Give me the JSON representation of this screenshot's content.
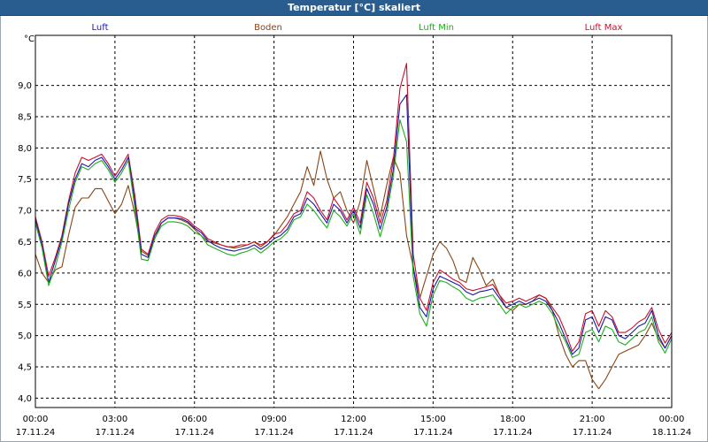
{
  "window": {
    "title": "Temperatur [°C] skaliert"
  },
  "chart_data": {
    "type": "line",
    "title": "Temperatur [°C] skaliert",
    "ylabel": "°C",
    "ylim": [
      3.85,
      9.8
    ],
    "xlim": [
      0,
      24
    ],
    "grid": true,
    "legend_position": "top",
    "y_ticks": [
      "4,0",
      "4,5",
      "5,0",
      "5,5",
      "6,0",
      "6,5",
      "7,0",
      "7,5",
      "8,0",
      "8,5",
      "9,0"
    ],
    "y_tick_values": [
      4.0,
      4.5,
      5.0,
      5.5,
      6.0,
      6.5,
      7.0,
      7.5,
      8.0,
      8.5,
      9.0
    ],
    "x_ticks": [
      {
        "time": "00:00",
        "date": "17.11.24"
      },
      {
        "time": "03:00",
        "date": "17.11.24"
      },
      {
        "time": "06:00",
        "date": "17.11.24"
      },
      {
        "time": "09:00",
        "date": "17.11.24"
      },
      {
        "time": "12:00",
        "date": "17.11.24"
      },
      {
        "time": "15:00",
        "date": "17.11.24"
      },
      {
        "time": "18:00",
        "date": "17.11.24"
      },
      {
        "time": "21:00",
        "date": "17.11.24"
      },
      {
        "time": "00:00",
        "date": "18.11.24"
      }
    ],
    "x_tick_values": [
      0,
      3,
      6,
      9,
      12,
      15,
      18,
      21,
      24
    ],
    "x": [
      0,
      0.25,
      0.5,
      0.75,
      1,
      1.25,
      1.5,
      1.75,
      2,
      2.25,
      2.5,
      2.75,
      3,
      3.25,
      3.5,
      3.75,
      4,
      4.25,
      4.5,
      4.75,
      5,
      5.25,
      5.5,
      5.75,
      6,
      6.25,
      6.5,
      6.75,
      7,
      7.25,
      7.5,
      7.75,
      8,
      8.25,
      8.5,
      8.75,
      9,
      9.25,
      9.5,
      9.75,
      10,
      10.25,
      10.5,
      10.75,
      11,
      11.25,
      11.5,
      11.75,
      12,
      12.25,
      12.5,
      12.75,
      13,
      13.25,
      13.5,
      13.75,
      14,
      14.25,
      14.5,
      14.75,
      15,
      15.25,
      15.5,
      15.75,
      16,
      16.25,
      16.5,
      16.75,
      17,
      17.25,
      17.5,
      17.75,
      18,
      18.25,
      18.5,
      18.75,
      19,
      19.25,
      19.5,
      19.75,
      20,
      20.25,
      20.5,
      20.75,
      21,
      21.25,
      21.5,
      21.75,
      22,
      22.25,
      22.5,
      22.75,
      23,
      23.25,
      23.5,
      23.75,
      24
    ],
    "series": [
      {
        "name": "Luft",
        "color": "#1a1aa8",
        "values": [
          6.85,
          6.45,
          5.85,
          6.2,
          6.55,
          7.1,
          7.5,
          7.75,
          7.7,
          7.8,
          7.85,
          7.7,
          7.5,
          7.65,
          7.85,
          7.15,
          6.3,
          6.25,
          6.6,
          6.8,
          6.88,
          6.88,
          6.87,
          6.82,
          6.72,
          6.65,
          6.52,
          6.45,
          6.4,
          6.37,
          6.35,
          6.38,
          6.4,
          6.45,
          6.38,
          6.45,
          6.55,
          6.6,
          6.7,
          6.9,
          6.95,
          7.2,
          7.1,
          6.95,
          6.8,
          7.1,
          7.0,
          6.8,
          7.0,
          6.72,
          7.35,
          7.1,
          6.7,
          7.05,
          7.65,
          8.7,
          8.85,
          6.1,
          5.45,
          5.3,
          5.75,
          5.95,
          5.9,
          5.85,
          5.8,
          5.7,
          5.65,
          5.7,
          5.72,
          5.75,
          5.6,
          5.45,
          5.5,
          5.55,
          5.5,
          5.55,
          5.6,
          5.55,
          5.4,
          5.2,
          4.95,
          4.7,
          4.8,
          5.25,
          5.3,
          5.05,
          5.3,
          5.25,
          5.0,
          4.95,
          5.05,
          5.15,
          5.2,
          5.4,
          5.0,
          4.8,
          5.0,
          5.2,
          5.25
        ]
      },
      {
        "name": "Boden",
        "color": "#8b4513",
        "values": [
          6.3,
          6.0,
          5.85,
          6.05,
          6.1,
          6.6,
          7.05,
          7.2,
          7.2,
          7.35,
          7.35,
          7.15,
          6.95,
          7.1,
          7.4,
          6.95,
          6.35,
          6.28,
          6.55,
          6.8,
          6.88,
          6.88,
          6.85,
          6.8,
          6.7,
          6.6,
          6.5,
          6.48,
          6.45,
          6.42,
          6.4,
          6.42,
          6.45,
          6.5,
          6.42,
          6.5,
          6.6,
          6.75,
          6.9,
          7.1,
          7.3,
          7.7,
          7.4,
          7.95,
          7.5,
          7.2,
          7.3,
          7.0,
          6.8,
          7.15,
          7.8,
          7.35,
          6.9,
          7.4,
          7.85,
          7.6,
          6.6,
          6.1,
          5.6,
          5.95,
          6.3,
          6.5,
          6.4,
          6.2,
          5.9,
          5.85,
          6.25,
          6.05,
          5.8,
          5.9,
          5.65,
          5.45,
          5.4,
          5.5,
          5.5,
          5.55,
          5.65,
          5.6,
          5.4,
          5.0,
          4.7,
          4.5,
          4.6,
          4.6,
          4.3,
          4.15,
          4.3,
          4.5,
          4.7,
          4.75,
          4.8,
          4.85,
          5.0,
          5.2,
          4.95,
          4.8,
          5.0,
          5.1,
          5.2
        ]
      },
      {
        "name": "Luft Min",
        "color": "#1fae1f",
        "values": [
          6.8,
          6.4,
          5.8,
          6.1,
          6.5,
          7.0,
          7.45,
          7.7,
          7.65,
          7.75,
          7.8,
          7.65,
          7.45,
          7.6,
          7.8,
          7.05,
          6.22,
          6.2,
          6.55,
          6.75,
          6.82,
          6.82,
          6.8,
          6.75,
          6.65,
          6.6,
          6.45,
          6.4,
          6.35,
          6.3,
          6.28,
          6.32,
          6.35,
          6.4,
          6.32,
          6.4,
          6.5,
          6.55,
          6.65,
          6.85,
          6.9,
          7.1,
          7.0,
          6.85,
          6.72,
          7.0,
          6.9,
          6.75,
          6.95,
          6.62,
          7.25,
          6.95,
          6.58,
          6.95,
          7.55,
          8.45,
          8.1,
          5.95,
          5.35,
          5.15,
          5.65,
          5.88,
          5.85,
          5.78,
          5.72,
          5.6,
          5.55,
          5.6,
          5.62,
          5.65,
          5.5,
          5.35,
          5.45,
          5.5,
          5.45,
          5.5,
          5.55,
          5.5,
          5.35,
          5.1,
          4.9,
          4.65,
          4.7,
          5.05,
          5.1,
          4.9,
          5.15,
          5.1,
          4.9,
          4.85,
          4.95,
          5.05,
          5.1,
          5.3,
          4.9,
          4.72,
          4.95,
          5.15,
          5.22
        ]
      },
      {
        "name": "Luft Max",
        "color": "#c8102e",
        "values": [
          6.9,
          6.5,
          5.95,
          6.25,
          6.6,
          7.15,
          7.6,
          7.85,
          7.8,
          7.85,
          7.9,
          7.75,
          7.55,
          7.72,
          7.9,
          7.25,
          6.38,
          6.3,
          6.65,
          6.85,
          6.92,
          6.92,
          6.9,
          6.85,
          6.75,
          6.68,
          6.55,
          6.5,
          6.45,
          6.42,
          6.42,
          6.45,
          6.45,
          6.5,
          6.45,
          6.5,
          6.62,
          6.65,
          6.78,
          6.95,
          7.0,
          7.3,
          7.2,
          7.0,
          6.85,
          7.2,
          7.05,
          6.85,
          7.05,
          6.8,
          7.45,
          7.2,
          6.8,
          7.15,
          7.8,
          8.95,
          9.35,
          6.3,
          5.6,
          5.4,
          5.85,
          6.05,
          5.98,
          5.9,
          5.85,
          5.75,
          5.72,
          5.75,
          5.78,
          5.82,
          5.65,
          5.52,
          5.55,
          5.6,
          5.55,
          5.6,
          5.65,
          5.6,
          5.45,
          5.3,
          5.05,
          4.75,
          4.9,
          5.35,
          5.4,
          5.15,
          5.4,
          5.3,
          5.05,
          5.05,
          5.12,
          5.22,
          5.28,
          5.45,
          5.1,
          4.88,
          5.05,
          5.22,
          5.28
        ]
      }
    ]
  }
}
